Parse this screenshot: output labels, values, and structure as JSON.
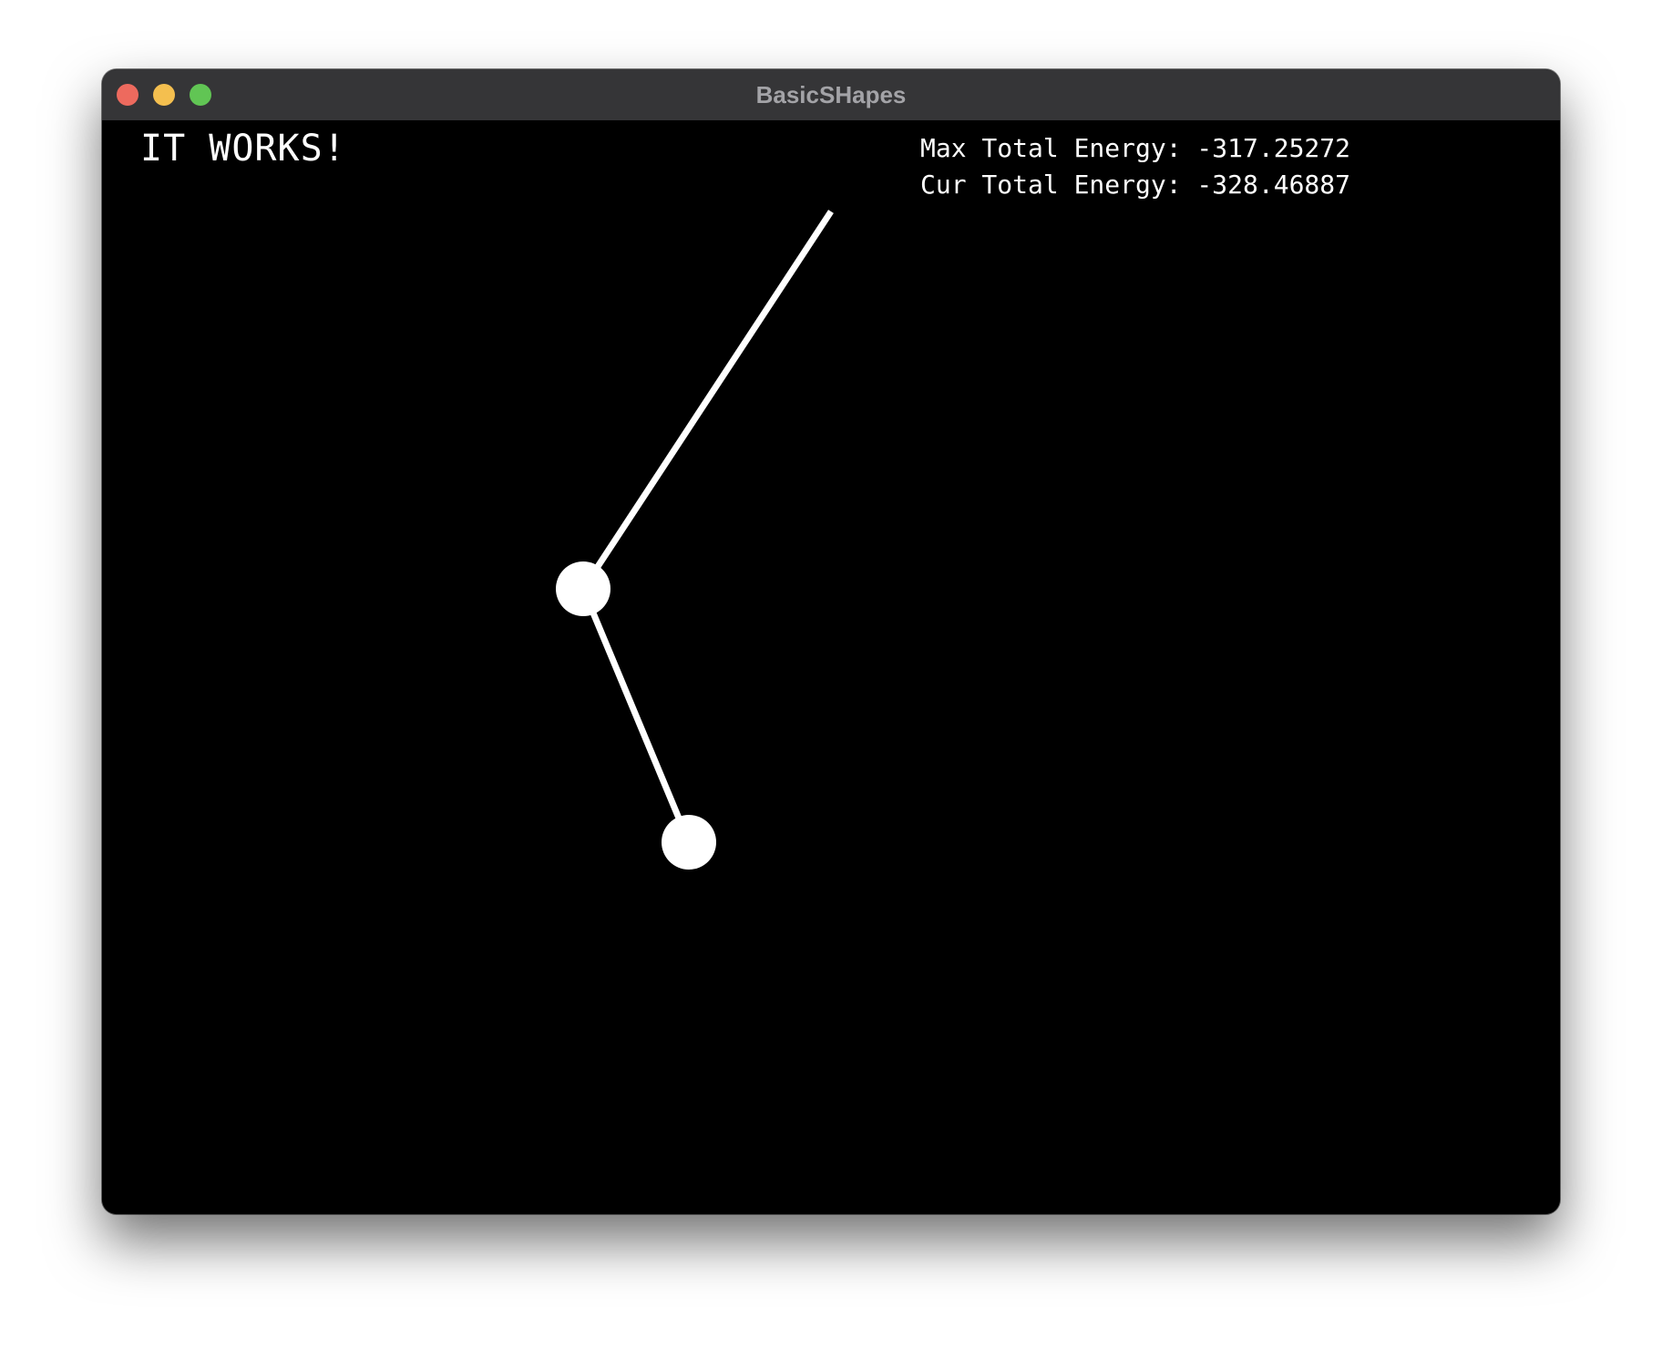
{
  "window": {
    "title": "BasicSHapes",
    "buttons": [
      {
        "name": "close",
        "color": "#ed6a5e"
      },
      {
        "name": "minimize",
        "color": "#f4bf4f"
      },
      {
        "name": "zoom",
        "color": "#61c554"
      }
    ]
  },
  "canvas": {
    "background": "#000000",
    "foreground": "#ffffff",
    "status_text": "IT WORKS!",
    "energy": {
      "max_line": "Max Total Energy: -317.25272",
      "cur_line": "Cur Total Energy: -328.46887"
    }
  },
  "pendulum": {
    "type": "double-pendulum",
    "bob_count": 2
  }
}
